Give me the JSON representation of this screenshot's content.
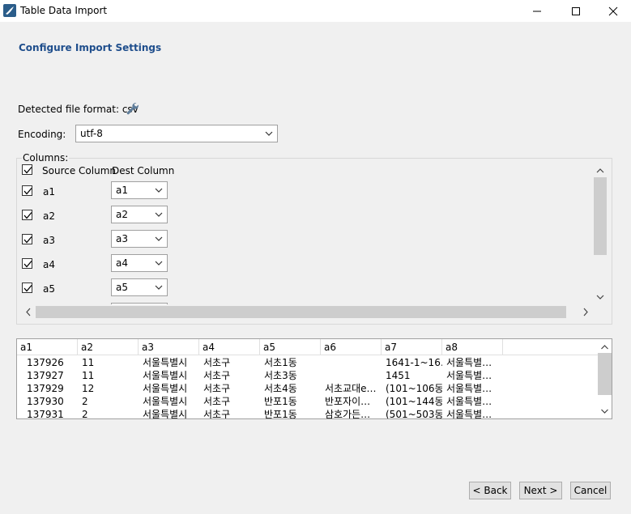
{
  "window": {
    "title": "Table Data Import",
    "controls": [
      "minimize",
      "maximize",
      "close"
    ]
  },
  "page": {
    "header": "Configure Import Settings",
    "detected_format_label": "Detected file format: csv",
    "encoding_label": "Encoding:",
    "encoding_value": "utf-8"
  },
  "columns": {
    "legend": "Columns:",
    "source_header": "Source Column",
    "dest_header": "Dest Column",
    "rows": [
      {
        "source": "a1",
        "dest": "a1"
      },
      {
        "source": "a2",
        "dest": "a2"
      },
      {
        "source": "a3",
        "dest": "a3"
      },
      {
        "source": "a4",
        "dest": "a4"
      },
      {
        "source": "a5",
        "dest": "a5"
      }
    ]
  },
  "preview": {
    "headers": [
      "a1",
      "a2",
      "a3",
      "a4",
      "a5",
      "a6",
      "a7",
      "a8"
    ],
    "rows": [
      [
        "137926",
        "11",
        "서울특별시",
        "서초구",
        "서초1동",
        "",
        "1641-1~16…",
        "서울특별…"
      ],
      [
        "137927",
        "11",
        "서울특별시",
        "서초구",
        "서초3동",
        "",
        "1451",
        "서울특별…"
      ],
      [
        "137929",
        "12",
        "서울특별시",
        "서초구",
        "서초4동",
        "서초교대e…",
        "(101~106동)",
        "서울특별…"
      ],
      [
        "137930",
        "2",
        "서울특별시",
        "서초구",
        "반포1동",
        "반포자이…",
        "(101~144동)",
        "서울특별…"
      ],
      [
        "137931",
        "2",
        "서울특별시",
        "서초구",
        "반포1동",
        "삼호가든…",
        "(501~503동)",
        "서울특별…"
      ]
    ]
  },
  "buttons": {
    "back": "< Back",
    "next": "Next >",
    "cancel": "Cancel"
  },
  "colors": {
    "header_text": "#1f4e8c",
    "window_bg": "#f0f0f0"
  }
}
